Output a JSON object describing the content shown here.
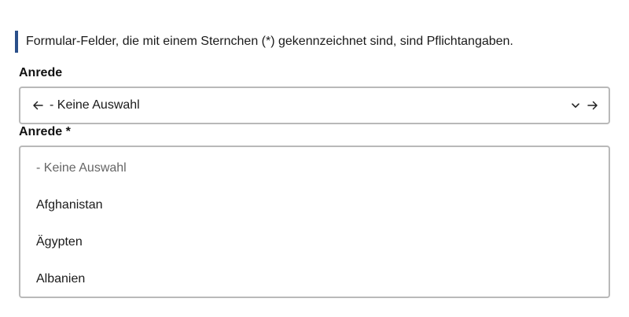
{
  "notice": {
    "text": "Formular-Felder, die mit einem Sternchen (*) gekennzeichnet sind, sind Pflichtangaben.",
    "accent_color": "#2a4f8a"
  },
  "field_salutation": {
    "label": "Anrede",
    "selected_value": "- Keine Auswahl",
    "left_icon": "arrow-left-icon",
    "dropdown_icon": "chevron-down-icon",
    "right_icon": "arrow-right-icon"
  },
  "field_salutation_required": {
    "label": "Anrede *",
    "options": [
      {
        "label": "- Keine Auswahl",
        "placeholder": true
      },
      {
        "label": "Afghanistan"
      },
      {
        "label": "Ägypten"
      },
      {
        "label": "Albanien"
      }
    ]
  },
  "colors": {
    "border": "#b9b9b9",
    "placeholder_text": "#666666",
    "text": "#1a1a1a"
  }
}
